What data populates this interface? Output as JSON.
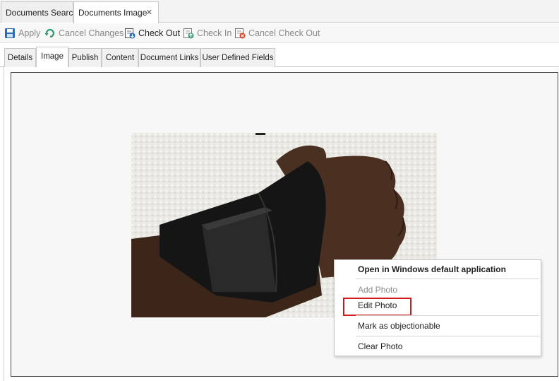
{
  "doc_tabs": [
    {
      "label": "Documents Search"
    },
    {
      "label": "Documents Image",
      "close_glyph": "✕"
    }
  ],
  "toolbar": {
    "apply": "Apply",
    "cancel_changes": "Cancel Changes",
    "check_out": "Check Out",
    "check_in": "Check In",
    "cancel_check_out": "Cancel Check Out"
  },
  "sub_tabs": [
    "Details",
    "Image",
    "Publish",
    "Content",
    "Document Links",
    "User Defined Fields"
  ],
  "selected_sub_tab": "Image",
  "context_menu": {
    "items": [
      {
        "label": "Open in Windows default application",
        "style": "bold"
      },
      {
        "label": "Add Photo",
        "style": "disabled"
      },
      {
        "label": "Edit Photo",
        "style": "highlight"
      },
      {
        "label": "Mark as objectionable",
        "style": "normal"
      },
      {
        "label": "Clear Photo",
        "style": "normal"
      }
    ]
  },
  "photo": {
    "subject": "hand-with-wrist-brace-photo"
  },
  "colors": {
    "highlight_box": "#d01a1a",
    "save_icon": "#2e6db5",
    "undo_icon": "#2f9a6c",
    "cancel_red": "#d9452b"
  }
}
